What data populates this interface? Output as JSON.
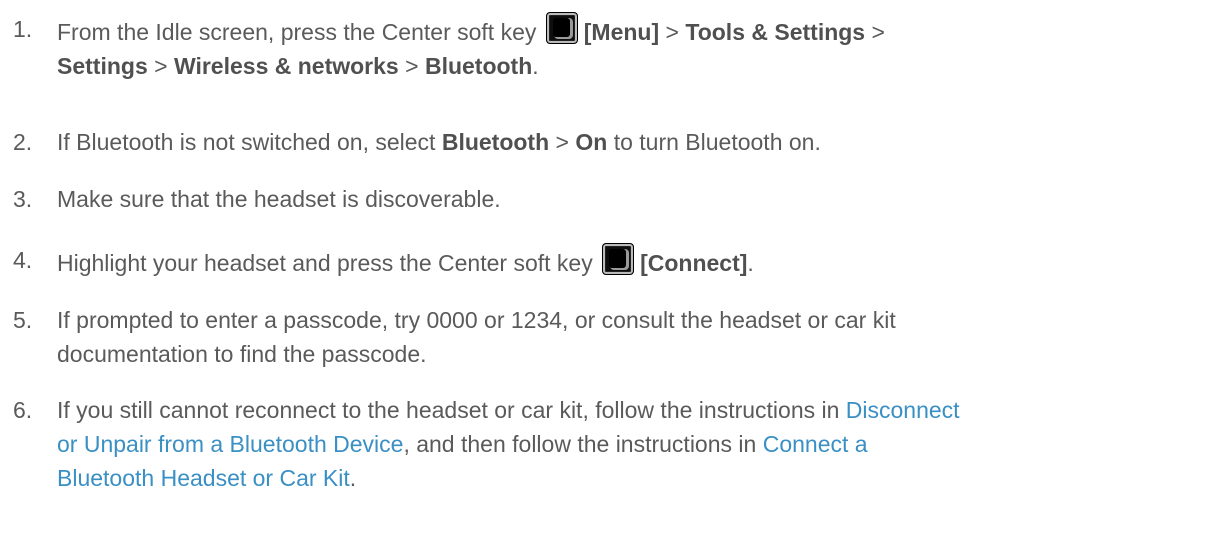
{
  "steps": [
    {
      "num": "1.",
      "lines": [
        [
          {
            "t": "text",
            "v": "From the Idle screen, press the Center soft key "
          },
          {
            "t": "icon",
            "name": "center-soft-key-icon"
          },
          {
            "t": "bold",
            "v": "[Menu]"
          },
          {
            "t": "text",
            "v": " > "
          },
          {
            "t": "bold",
            "v": "Tools & Settings"
          },
          {
            "t": "text",
            "v": " >"
          }
        ],
        [
          {
            "t": "bold",
            "v": "Settings"
          },
          {
            "t": "text",
            "v": " > "
          },
          {
            "t": "bold",
            "v": "Wireless & networks"
          },
          {
            "t": "text",
            "v": " > "
          },
          {
            "t": "bold",
            "v": "Bluetooth"
          },
          {
            "t": "text",
            "v": "."
          }
        ]
      ]
    },
    {
      "num": "2.",
      "lines": [
        [
          {
            "t": "text",
            "v": "If Bluetooth is not switched on, select "
          },
          {
            "t": "bold",
            "v": "Bluetooth"
          },
          {
            "t": "text",
            "v": " > "
          },
          {
            "t": "bold",
            "v": "On"
          },
          {
            "t": "text",
            "v": " to turn Bluetooth on."
          }
        ]
      ]
    },
    {
      "num": "3.",
      "lines": [
        [
          {
            "t": "text",
            "v": "Make sure that the headset is discoverable."
          }
        ]
      ]
    },
    {
      "num": "4.",
      "lines": [
        [
          {
            "t": "text",
            "v": "Highlight your headset and press the Center soft key "
          },
          {
            "t": "icon",
            "name": "center-soft-key-icon"
          },
          {
            "t": "bold",
            "v": "[Connect]"
          },
          {
            "t": "text",
            "v": "."
          }
        ]
      ]
    },
    {
      "num": "5.",
      "lines": [
        [
          {
            "t": "text",
            "v": "If prompted to enter a passcode, try 0000 or 1234, or consult the headset or car kit"
          }
        ],
        [
          {
            "t": "text",
            "v": "documentation to find the passcode."
          }
        ]
      ]
    },
    {
      "num": "6.",
      "lines": [
        [
          {
            "t": "text",
            "v": "If you still cannot reconnect to the headset or car kit, follow the instructions in "
          },
          {
            "t": "link",
            "v": "Disconnect"
          }
        ],
        [
          {
            "t": "link",
            "v": "or Unpair from a Bluetooth Device"
          },
          {
            "t": "text",
            "v": ", and then follow the instructions in "
          },
          {
            "t": "link",
            "v": "Connect a"
          }
        ],
        [
          {
            "t": "link",
            "v": "Bluetooth Headset or Car Kit"
          },
          {
            "t": "text",
            "v": "."
          }
        ]
      ]
    }
  ],
  "colors": {
    "text": "#5a5a5a",
    "link": "#3a8fc4"
  }
}
